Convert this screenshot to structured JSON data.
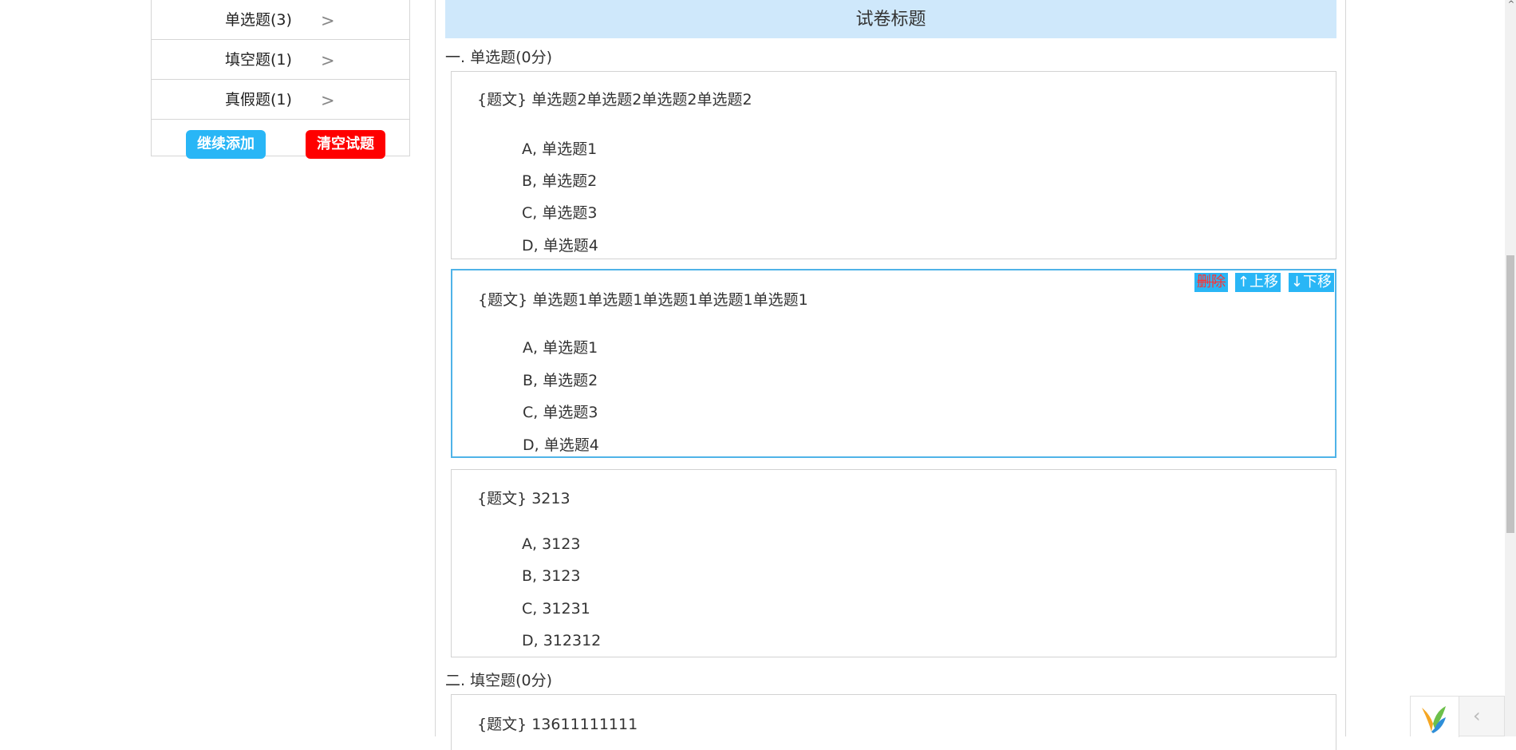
{
  "sidebar": {
    "items": [
      {
        "label": "单选题(3)",
        "chevron": ">"
      },
      {
        "label": "填空题(1)",
        "chevron": ">"
      },
      {
        "label": "真假题(1)",
        "chevron": ">"
      }
    ],
    "continue_add_label": "继续添加",
    "clear_label": "清空试题"
  },
  "paper": {
    "title": "试卷标题",
    "sections": [
      {
        "heading": "一. 单选题(0分)",
        "questions": [
          {
            "text": "{题文} 单选题2单选题2单选题2单选题2",
            "options": [
              "A, 单选题1",
              "B, 单选题2",
              "C, 单选题3",
              "D, 单选题4"
            ]
          },
          {
            "text": "{题文} 单选题1单选题1单选题1单选题1单选题1",
            "options": [
              "A, 单选题1",
              "B, 单选题2",
              "C, 单选题3",
              "D, 单选题4"
            ],
            "controls": {
              "delete": "删除",
              "up": "↑上移",
              "down": "↓下移"
            }
          },
          {
            "text": "{题文} 3213",
            "options": [
              "A, 3123",
              "B, 3123",
              "C, 31231",
              "D, 312312"
            ]
          }
        ]
      },
      {
        "heading": "二. 填空题(0分)",
        "questions": [
          {
            "text": "{题文} 13611111111"
          }
        ]
      }
    ]
  },
  "widget": {
    "arrow": "‹",
    "logo_icon": "yii-logo-icon"
  },
  "scrollbar": {
    "up_arrow": "^"
  },
  "colors": {
    "accent": "#29b6f6",
    "danger": "#ff0000",
    "title_bg": "#cfe8fb",
    "active_border": "#4fb3e8"
  }
}
